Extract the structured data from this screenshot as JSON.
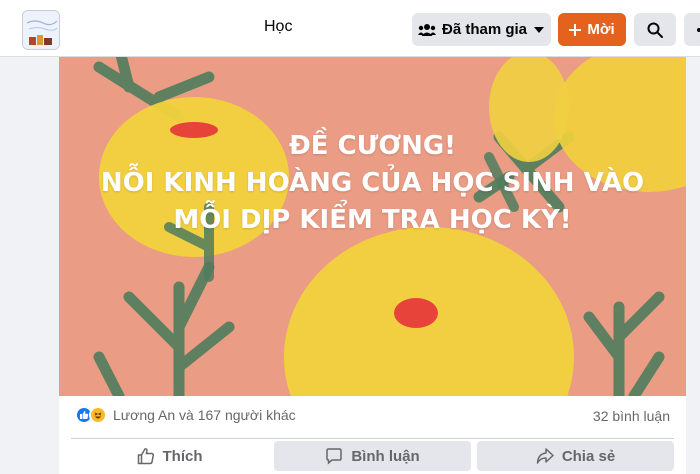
{
  "header": {
    "group_title": "Học",
    "joined_label": "Đã tham gia",
    "invite_label": "Mời",
    "icons": [
      "group-thumbnail",
      "people-icon",
      "caret-down-icon",
      "plus-icon",
      "search-icon",
      "more-icon"
    ]
  },
  "cover": {
    "lines": [
      "ĐỀ CƯƠNG!",
      "NỖI KINH HOÀNG CỦA HỌC SINH VÀO",
      "MỖI DỊP KIỂM TRA HỌC KỲ!"
    ],
    "colors": {
      "background": "#ea9c85",
      "flower": "#f2d23c",
      "leaf": "#4f7d5e",
      "mark": "#e8433a"
    }
  },
  "post": {
    "reactions_text": "Lương An và 167 người khác",
    "comments_text": "32 bình luận",
    "actions": {
      "like": "Thích",
      "comment": "Bình luận",
      "share": "Chia sẻ"
    }
  },
  "colors": {
    "invite_button": "#e4611e",
    "like_blue": "#1877f2",
    "haha_yellow": "#f7b928"
  }
}
